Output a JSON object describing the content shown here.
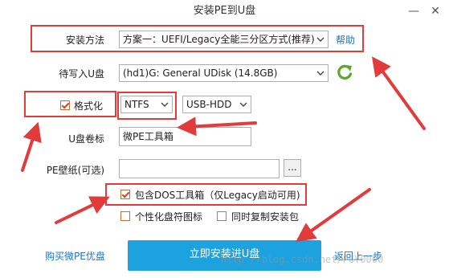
{
  "window": {
    "title": "安装PE到U盘",
    "minimize_glyph": "—",
    "close_glyph": "✕"
  },
  "install_method": {
    "label": "安装方法",
    "value": "方案一：UEFI/Legacy全能三分区方式(推荐)",
    "help_link": "帮助"
  },
  "target_disk": {
    "label": "待写入U盘",
    "value": "(hd1)G: General UDisk (14.8GB)",
    "refresh_icon": "refresh-icon"
  },
  "format": {
    "label": "格式化",
    "checked": true,
    "filesystem": "NTFS",
    "mode": "USB-HDD"
  },
  "volume_label": {
    "label": "U盘卷标",
    "value": "微PE工具箱"
  },
  "wallpaper": {
    "label": "PE壁纸(可选)",
    "value": "",
    "browse_label": "..."
  },
  "options": {
    "dos_tools": {
      "label": "包含DOS工具箱（仅Legacy启动可用)",
      "checked": true
    },
    "custom_icon": {
      "label": "个性化盘符图标",
      "checked": false
    },
    "copy_installer": {
      "label": "同时复制安装包",
      "checked": false
    }
  },
  "footer": {
    "buy_link": "购买微PE优盘",
    "install_button": "立即安装进U盘",
    "back_link": "返回上一步",
    "watermark": "http://blog.csdn.net/PGY0000"
  },
  "colors": {
    "accent": "#1ca2df",
    "annotation_red": "#e23b3b",
    "link": "#1a73c8",
    "refresh_green": "#5aa832"
  }
}
